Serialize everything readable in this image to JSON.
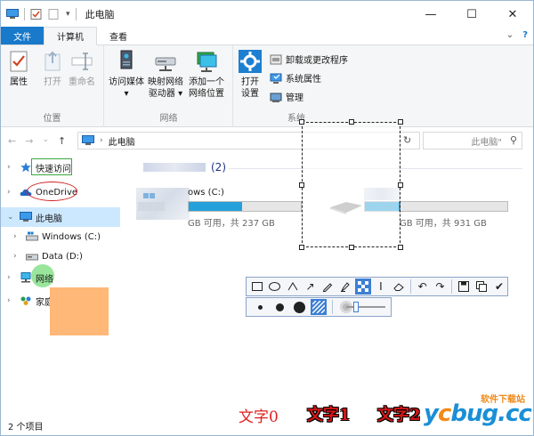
{
  "window": {
    "title": "此电脑",
    "controls": {
      "minimize": "—",
      "maximize": "☐",
      "close": "✕"
    }
  },
  "tabs": [
    {
      "label": "文件"
    },
    {
      "label": "计算机"
    },
    {
      "label": "查看"
    }
  ],
  "tabs_right": {
    "chevron": "⌄",
    "help": "?"
  },
  "ribbon": {
    "groups": [
      {
        "label": "位置",
        "buttons": [
          "属性",
          "打开",
          "重命名"
        ]
      },
      {
        "label": "网络",
        "buttons": [
          {
            "line1": "访问媒体",
            "line2": "▾"
          },
          {
            "line1": "映射网络",
            "line2": "驱动器 ▾"
          },
          {
            "line1": "添加一个",
            "line2": "网络位置"
          }
        ]
      },
      {
        "label": "系统",
        "big": {
          "line1": "打开",
          "line2": "设置"
        },
        "small": [
          "卸载或更改程序",
          "系统属性",
          "管理"
        ]
      }
    ]
  },
  "nav": {
    "back": "←",
    "forward": "→",
    "recent": "⌄",
    "up": "↑",
    "address": "此电脑",
    "search_placeholder": "此电脑\"",
    "refresh": "↻",
    "search_icon": "⚲"
  },
  "navpane": [
    {
      "label": "快速访问",
      "expander": "›"
    },
    {
      "label": "OneDrive",
      "expander": "›"
    },
    {
      "label": "此电脑",
      "expander": "⌄"
    },
    {
      "label": "Windows (C:)",
      "expander": "›"
    },
    {
      "label": "Data (D:)",
      "expander": "›"
    },
    {
      "label": "网络",
      "expander": "›"
    },
    {
      "label": "家庭组",
      "expander": "›"
    }
  ],
  "content": {
    "section_count": "(2)",
    "drives": [
      {
        "name": "ows (C:)",
        "free": "GB 可用，共 237 GB",
        "used_fraction": 0.48
      },
      {
        "name": "",
        "free": "GB 可用，共 931 GB",
        "used_fraction": 0.25
      }
    ]
  },
  "status": {
    "items": "2 个项目"
  },
  "snip_toolbar": {
    "tools": [
      "rectangle",
      "ellipse",
      "line",
      "arrow",
      "pencil",
      "highlighter",
      "mosaic",
      "text",
      "eraser",
      "undo",
      "redo",
      "save",
      "copy",
      "done"
    ],
    "glyphs": {
      "text": "I",
      "undo": "↶",
      "redo": "↷",
      "done": "✔",
      "arrow": "↗"
    }
  },
  "annotations": {
    "text0": "文字0",
    "text1": "文字1",
    "text2": "文字2"
  },
  "watermark": {
    "top": "软件下载站",
    "main_prefix": "y",
    "main_o": "c",
    "main_suffix": "bug.cc"
  },
  "colors": {
    "accent": "#1979ca",
    "selection": "#cce8ff",
    "drive_fill": "#26a0da",
    "annotation_red": "#d31717",
    "annotation_green": "#3aa83a",
    "highlight_orange": "#ffb877"
  }
}
